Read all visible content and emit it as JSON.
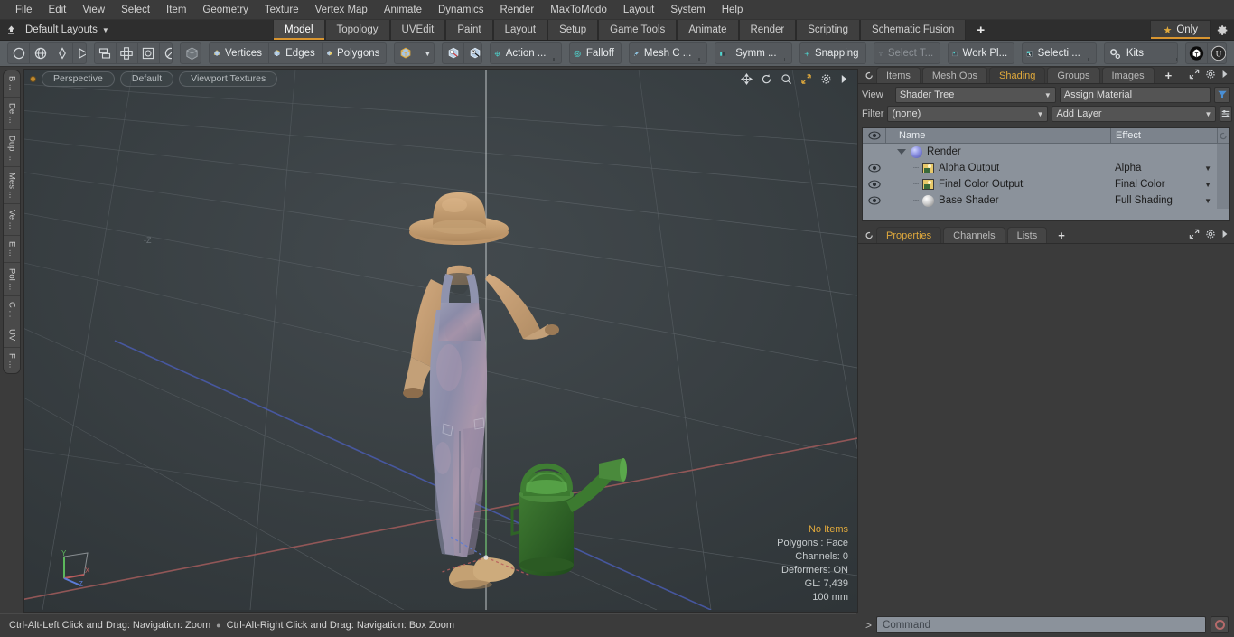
{
  "menubar": {
    "items": [
      "File",
      "Edit",
      "View",
      "Select",
      "Item",
      "Geometry",
      "Texture",
      "Vertex Map",
      "Animate",
      "Dynamics",
      "Render",
      "MaxToModo",
      "Layout",
      "System",
      "Help"
    ]
  },
  "layoutbar": {
    "layout_selector": "Default Layouts",
    "tabs": [
      {
        "label": "Model",
        "active": true
      },
      {
        "label": "Topology",
        "active": false
      },
      {
        "label": "UVEdit",
        "active": false
      },
      {
        "label": "Paint",
        "active": false
      },
      {
        "label": "Layout",
        "active": false
      },
      {
        "label": "Setup",
        "active": false
      },
      {
        "label": "Game Tools",
        "active": false
      },
      {
        "label": "Animate",
        "active": false
      },
      {
        "label": "Render",
        "active": false
      },
      {
        "label": "Scripting",
        "active": false
      },
      {
        "label": "Schematic Fusion",
        "active": false
      }
    ],
    "add_tab": "+",
    "only_button": "Only",
    "accent_color": "#d89530"
  },
  "toolbar": {
    "primitives": [
      "circle-icon",
      "globe-icon",
      "pen-tool-icon",
      "curve-tool-icon"
    ],
    "mesh_ops": [
      "mirror-icon",
      "array-icon",
      "bevel-icon",
      "sphere-falloff-icon"
    ],
    "element_cube": "cube-icon",
    "selection_modes": [
      {
        "label": "Vertices",
        "icon": "vertex-cube-icon"
      },
      {
        "label": "Edges",
        "icon": "edge-cube-icon"
      },
      {
        "label": "Polygons",
        "icon": "polygon-cube-icon"
      }
    ],
    "items_cube": "items-cube-icon",
    "dropdown_caret": "caret-down-icon",
    "snap_cubes": [
      "snap-cube-red-icon",
      "snap-cube-black-icon"
    ],
    "modes": [
      {
        "label": "Action  ...",
        "icon": "action-center-icon",
        "dim": false
      },
      {
        "label": "Falloff",
        "icon": "falloff-icon",
        "dim": false
      },
      {
        "label": "Mesh C ...",
        "icon": "mesh-constraint-icon",
        "dim": false
      },
      {
        "label": "Symm ...",
        "icon": "symmetry-icon",
        "dim": false
      },
      {
        "label": "Snapping",
        "icon": "snapping-icon",
        "dim": false
      },
      {
        "label": "Select T...",
        "icon": "select-through-icon",
        "dim": true
      },
      {
        "label": "Work Pl...",
        "icon": "work-plane-icon",
        "dim": false
      },
      {
        "label": "Selecti ...",
        "icon": "selection-set-icon",
        "dim": false
      }
    ],
    "kits": {
      "label": "Kits",
      "icon": "gears-icon"
    },
    "app_icons": [
      "modo-cube-icon",
      "unreal-engine-icon"
    ]
  },
  "leftbar": {
    "tabs": [
      "B ...",
      "De ...",
      "Dup ...",
      "Mes ...",
      "Ve ...",
      "E ...",
      "Pol ...",
      "C ...",
      "UV",
      "F ..."
    ]
  },
  "viewport": {
    "header": {
      "indicator": "active-viewport-dot",
      "pills": [
        "Perspective",
        "Default",
        "Viewport Textures"
      ],
      "icons": [
        "pan-icon",
        "rotate-icon",
        "zoom-icon",
        "fullscreen-icon",
        "gear-icon",
        "arrow-right-icon"
      ]
    },
    "stats": {
      "items": "No Items",
      "polygons": "Polygons : Face",
      "channels": "Channels: 0",
      "deformers": "Deformers: ON",
      "gl": "GL: 7,439",
      "scale": "100 mm"
    },
    "axis_gizmo": {
      "x": "X",
      "y": "Y",
      "z": "Z",
      "x_color": "#b85c5c",
      "y_color": "#5cb85c",
      "z_color": "#5c7cd8"
    },
    "grid_label": "-Z",
    "scene_description": "3D character mesh wearing a wide-brim hat, long-sleeve shirt and denim overalls with boots, standing beside a green watering can"
  },
  "rightpanel": {
    "tabs_top": [
      {
        "label": "Items",
        "active": false
      },
      {
        "label": "Mesh Ops",
        "active": false
      },
      {
        "label": "Shading",
        "active": true
      },
      {
        "label": "Groups",
        "active": false
      },
      {
        "label": "Images",
        "active": false
      }
    ],
    "tabs_top_add": "+",
    "shading": {
      "view_label": "View",
      "view_value": "Shader Tree",
      "assign_material": "Assign Material",
      "filter_label": "Filter",
      "filter_value": "(none)",
      "add_layer": "Add Layer",
      "filter_icon": "funnel-icon",
      "options_icon": "list-options-icon",
      "columns": {
        "eye": "visibility-icon",
        "name": "Name",
        "effect": "Effect"
      },
      "rows": [
        {
          "name": "Render",
          "effect": "",
          "icon": "sphere-blue-icon",
          "depth": 0,
          "eye": false,
          "expander": true
        },
        {
          "name": "Alpha Output",
          "effect": "Alpha",
          "icon": "image-output-icon",
          "depth": 1,
          "eye": true,
          "expander": false
        },
        {
          "name": "Final Color Output",
          "effect": "Final Color",
          "icon": "image-output-icon",
          "depth": 1,
          "eye": true,
          "expander": false
        },
        {
          "name": "Base Shader",
          "effect": "Full Shading",
          "icon": "sphere-grey-icon",
          "depth": 1,
          "eye": true,
          "expander": false
        }
      ]
    },
    "tabs_bottom": [
      {
        "label": "Properties",
        "active": true
      },
      {
        "label": "Channels",
        "active": false
      },
      {
        "label": "Lists",
        "active": false
      }
    ],
    "tabs_bottom_add": "+",
    "panel_icons": [
      "popout-icon",
      "gear-icon",
      "arrow-right-icon"
    ]
  },
  "statusbar": {
    "hint_left": "Ctrl-Alt-Left Click and Drag: Navigation: Zoom",
    "separator": "●",
    "hint_right": "Ctrl-Alt-Right Click and Drag: Navigation: Box Zoom",
    "command_prompt": ">",
    "command_placeholder": "Command",
    "command_value": "",
    "record_icon": "record-circle-icon"
  }
}
